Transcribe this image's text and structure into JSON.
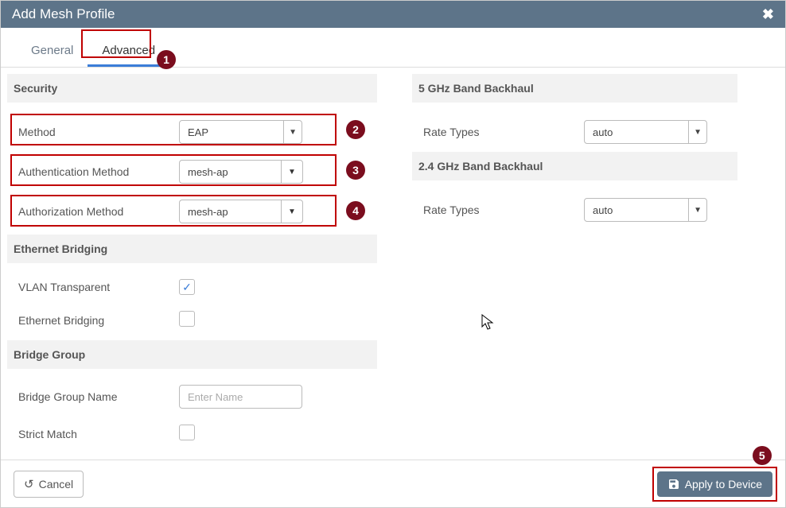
{
  "header": {
    "title": "Add Mesh Profile"
  },
  "tabs": {
    "general": "General",
    "advanced": "Advanced"
  },
  "left": {
    "security_header": "Security",
    "method_label": "Method",
    "method_value": "EAP",
    "auth_label": "Authentication Method",
    "auth_value": "mesh-ap",
    "authz_label": "Authorization Method",
    "authz_value": "mesh-ap",
    "eth_header": "Ethernet Bridging",
    "vlan_label": "VLAN Transparent",
    "vlan_checked": true,
    "eth_label": "Ethernet Bridging",
    "eth_checked": false,
    "bg_header": "Bridge Group",
    "bg_name_label": "Bridge Group Name",
    "bg_name_placeholder": "Enter Name",
    "bg_name_value": "",
    "strict_label": "Strict Match",
    "strict_checked": false
  },
  "right": {
    "bh5_header": "5 GHz Band Backhaul",
    "rate5_label": "Rate Types",
    "rate5_value": "auto",
    "bh24_header": "2.4 GHz Band Backhaul",
    "rate24_label": "Rate Types",
    "rate24_value": "auto"
  },
  "footer": {
    "cancel": "Cancel",
    "apply": "Apply to Device"
  },
  "callouts": {
    "c1": "1",
    "c2": "2",
    "c3": "3",
    "c4": "4",
    "c5": "5"
  }
}
